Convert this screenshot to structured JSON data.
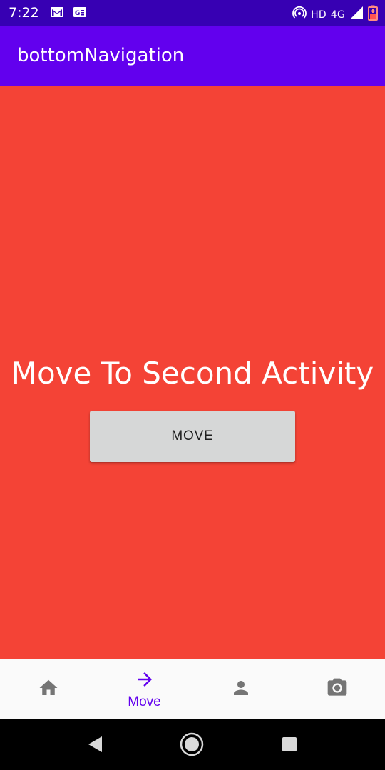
{
  "status_bar": {
    "time": "7:22",
    "icons_left": [
      "gmail-icon",
      "news-icon"
    ],
    "network_text": "HD",
    "network_type": "4G",
    "icons_right": [
      "hotspot-icon",
      "signal-icon",
      "battery-icon"
    ]
  },
  "app_bar": {
    "title": "bottomNavigation",
    "background": "#6200ee"
  },
  "content": {
    "background": "#f44336",
    "heading": "Move To Second Activity",
    "button_label": "MOVE"
  },
  "bottom_nav": {
    "items": [
      {
        "icon": "home-icon",
        "label": "",
        "selected": false
      },
      {
        "icon": "arrow-right-icon",
        "label": "Move",
        "selected": true
      },
      {
        "icon": "person-icon",
        "label": "",
        "selected": false
      },
      {
        "icon": "camera-icon",
        "label": "",
        "selected": false
      }
    ],
    "selected_color": "#6200ee",
    "unselected_color": "#757575"
  },
  "system_nav": {
    "buttons": [
      "back-icon",
      "home-circle-icon",
      "recents-icon"
    ]
  }
}
